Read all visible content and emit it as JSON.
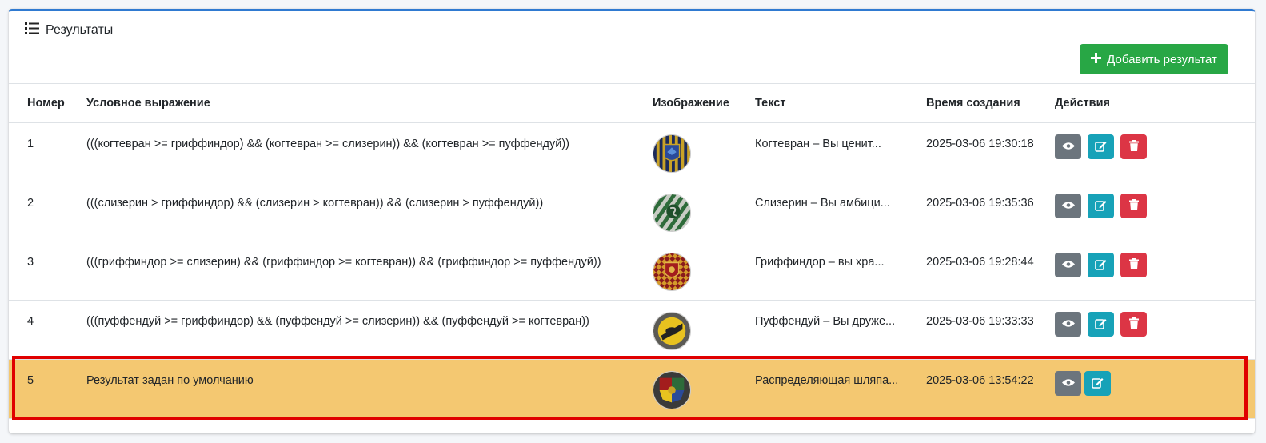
{
  "card": {
    "title": "Результаты",
    "add_button_label": "Добавить результат",
    "icons": {
      "title": "list-icon",
      "add": "plus-icon"
    }
  },
  "table": {
    "headers": [
      "Номер",
      "Условное выражение",
      "Изображение",
      "Текст",
      "Время создания",
      "Действия"
    ],
    "rows": [
      {
        "num": "1",
        "expr": "(((когтевран >= гриффиндор) && (когтевран >= слизерин)) && (когтевран >= пуффендуй))",
        "image": "ravenclaw-crest",
        "text": "Когтевран – Вы ценит...",
        "time": "2025-03-06 19:30:18",
        "actions": [
          "view",
          "edit",
          "delete"
        ]
      },
      {
        "num": "2",
        "expr": "(((слизерин > гриффиндор) && (слизерин > когтевран)) && (слизерин > пуффендуй))",
        "image": "slytherin-crest",
        "text": "Слизерин – Вы амбици...",
        "time": "2025-03-06 19:35:36",
        "actions": [
          "view",
          "edit",
          "delete"
        ]
      },
      {
        "num": "3",
        "expr": "(((гриффиндор >= слизерин) && (гриффиндор >= когтевран)) && (гриффиндор >= пуффендуй))",
        "image": "gryffindor-crest",
        "text": "Гриффиндор – вы хра...",
        "time": "2025-03-06 19:28:44",
        "actions": [
          "view",
          "edit",
          "delete"
        ]
      },
      {
        "num": "4",
        "expr": "(((пуффендуй >= гриффиндор) && (пуффендуй >= слизерин)) && (пуффендуй >= когтевран))",
        "image": "hufflepuff-crest",
        "text": "Пуффендуй – Вы друже...",
        "time": "2025-03-06 19:33:33",
        "actions": [
          "view",
          "edit",
          "delete"
        ]
      },
      {
        "num": "5",
        "expr": "Результат задан по умолчанию",
        "image": "hogwarts-crest",
        "text": "Распределяющая шляпа...",
        "time": "2025-03-06 13:54:22",
        "actions": [
          "view",
          "edit"
        ],
        "highlighted": true
      }
    ]
  },
  "colors": {
    "accent_border": "#2f7ad1",
    "add_button": "#28a745",
    "view_button": "#6c757d",
    "edit_button": "#17a2b8",
    "delete_button": "#dc3545",
    "highlight_row": "#f4c871",
    "annotation_frame": "#e00000"
  }
}
